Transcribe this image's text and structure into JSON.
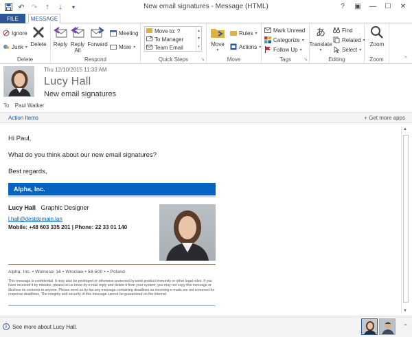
{
  "window": {
    "title": "New email signatures - Message (HTML)",
    "controls": [
      "?",
      "▣",
      "—",
      "☐",
      "✕"
    ]
  },
  "qat": [
    "save-icon",
    "undo-icon",
    "redo-icon",
    "up-icon",
    "down-icon",
    "more-icon"
  ],
  "tabs": {
    "file": "FILE",
    "message": "MESSAGE"
  },
  "ribbon": {
    "delete_group": {
      "label": "Delete",
      "ignore": "Ignore",
      "junk": "Junk",
      "delete": "Delete"
    },
    "respond_group": {
      "label": "Respond",
      "reply": "Reply",
      "reply_all_1": "Reply",
      "reply_all_2": "All",
      "forward": "Forward",
      "meeting": "Meeting",
      "more": "More"
    },
    "quicksteps_group": {
      "label": "Quick Steps",
      "items": [
        "Move to: ?",
        "To Manager",
        "Team Email"
      ]
    },
    "move_group": {
      "label": "Move",
      "move": "Move",
      "rules": "Rules",
      "actions": "Actions"
    },
    "tags_group": {
      "label": "Tags",
      "mark_unread": "Mark Unread",
      "categorize": "Categorize",
      "follow_up": "Follow Up"
    },
    "editing_group": {
      "label": "Editing",
      "translate": "Translate",
      "find": "Find",
      "related": "Related",
      "select": "Select"
    },
    "zoom_group": {
      "label": "Zoom",
      "zoom": "Zoom"
    }
  },
  "header": {
    "date": "Thu 12/10/2015 11:33 AM",
    "sender": "Lucy  Hall",
    "subject": "New email signatures",
    "to_label": "To",
    "to": "Paul Walker"
  },
  "actionbar": {
    "action_items": "Action Items",
    "get_more": "Get more apps"
  },
  "message": {
    "greeting": "Hi Paul,",
    "line1": "What do you think about our new email signatures?",
    "closing": "Best regards,"
  },
  "signature": {
    "company": "Alpha, Inc.",
    "name": "Lucy Hall",
    "title": "Graphic Designer",
    "email": "l.hall@destdomain.lan",
    "mobile_phone": "Mobile:  +48 603 335 201 | Phone: 22 33 01 140",
    "address": "Alpha, Inc. • Wolnosci 16 • Wroclaw  • 58-500 • • Poland",
    "disclaimer": "This message is confidential. It may also be privileged or otherwise protected by work product immunity or other legal rules. If you have received it by mistake, please let us know by e-mail reply and delete it from your system; you may not copy this message or disclose its contents to anyone. Please send us by fax any message containing deadlines as incoming e-mails are not screened for response deadlines. The integrity and security of this message cannot be guaranteed on the Internet."
  },
  "people_pane": {
    "text": "See more about Lucy  Hall."
  },
  "colors": {
    "accent": "#2b579a",
    "banner": "#0563c1"
  }
}
